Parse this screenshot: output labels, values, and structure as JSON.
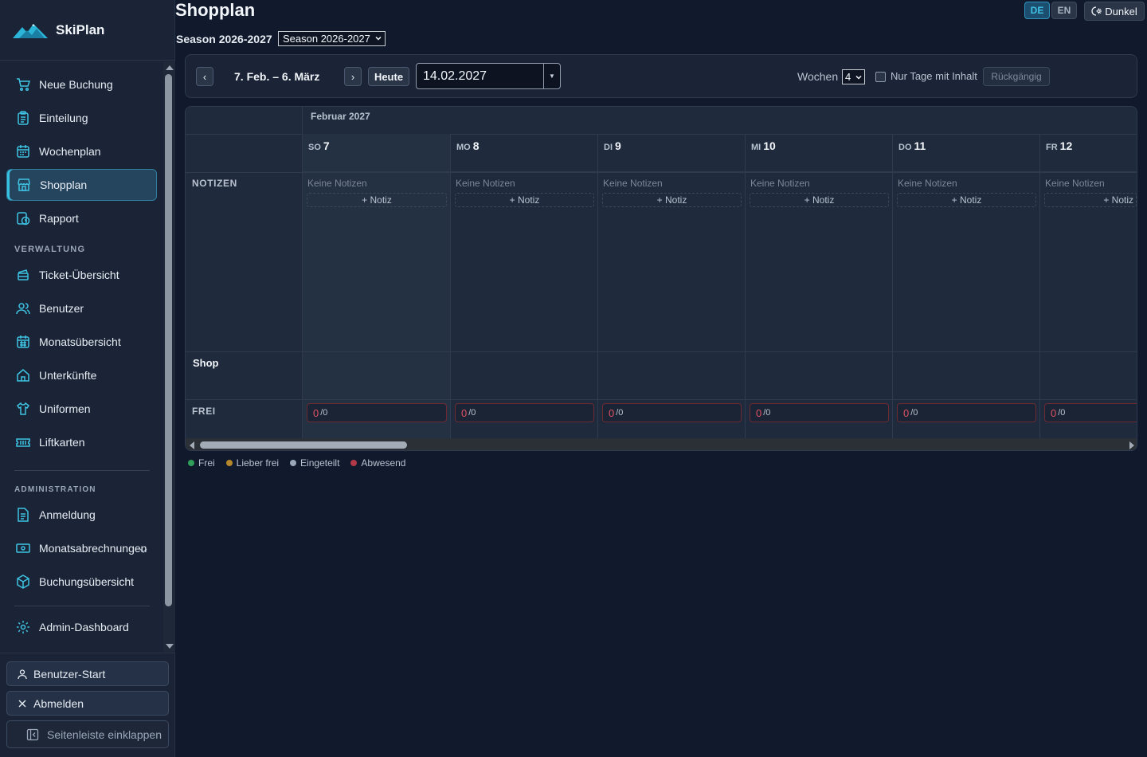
{
  "app": {
    "name": "SkiPlan"
  },
  "sidebar": {
    "items": [
      {
        "label": "Neue Buchung",
        "icon": "cart-icon"
      },
      {
        "label": "Einteilung",
        "icon": "clipboard-icon"
      },
      {
        "label": "Wochenplan",
        "icon": "calendar-icon"
      },
      {
        "label": "Shopplan",
        "icon": "store-icon",
        "active": true
      },
      {
        "label": "Rapport",
        "icon": "report-clock-icon"
      }
    ],
    "section_verwaltung": "VERWALTUNG",
    "verwaltung_items": [
      {
        "label": "Ticket-Übersicht",
        "icon": "ticket-icon"
      },
      {
        "label": "Benutzer",
        "icon": "users-icon"
      },
      {
        "label": "Monatsübersicht",
        "icon": "calendar-grid-icon"
      },
      {
        "label": "Unterkünfte",
        "icon": "home-icon"
      },
      {
        "label": "Uniformen",
        "icon": "shirt-icon"
      },
      {
        "label": "Liftkarten",
        "icon": "card-ticket-icon"
      }
    ],
    "section_admin": "ADMINISTRATION",
    "admin_items": [
      {
        "label": "Anmeldung",
        "icon": "document-icon"
      },
      {
        "label": "Monatsabrechnungen",
        "icon": "money-icon"
      },
      {
        "label": "Buchungsübersicht",
        "icon": "box-icon"
      }
    ],
    "dashboard": {
      "label": "Admin-Dashboard",
      "icon": "gear-icon"
    },
    "bottom": {
      "user_start": "Benutzer-Start",
      "logout": "Abmelden",
      "collapse": "Seitenleiste einklappen"
    }
  },
  "header": {
    "title": "Shopplan",
    "season_label": "Season 2026-2027",
    "season_select": "Season 2026-2027",
    "lang": [
      "DE",
      "EN"
    ],
    "lang_active": "DE",
    "theme": "Dunkel"
  },
  "toolbar": {
    "prev": "‹",
    "next": "›",
    "range": "7. Feb. – 6. März",
    "today": "Heute",
    "date": "14.02.2027",
    "weeks_label": "Wochen",
    "weeks_value": "4",
    "only_content_label": "Nur Tage mit Inhalt",
    "undo": "Rückgängig"
  },
  "calendar": {
    "month": "Februar 2027",
    "rows": {
      "notes": "NOTIZEN",
      "shop": "Shop",
      "free": "FREI"
    },
    "days": [
      {
        "dow": "SO",
        "num": "7",
        "today": true,
        "notes": "Keine Notizen",
        "add": "+ Notiz",
        "free": "0",
        "total": "/0"
      },
      {
        "dow": "MO",
        "num": "8",
        "notes": "Keine Notizen",
        "add": "+ Notiz",
        "free": "0",
        "total": "/0"
      },
      {
        "dow": "DI",
        "num": "9",
        "notes": "Keine Notizen",
        "add": "+ Notiz",
        "free": "0",
        "total": "/0"
      },
      {
        "dow": "MI",
        "num": "10",
        "notes": "Keine Notizen",
        "add": "+ Notiz",
        "free": "0",
        "total": "/0"
      },
      {
        "dow": "DO",
        "num": "11",
        "notes": "Keine Notizen",
        "add": "+ Notiz",
        "free": "0",
        "total": "/0"
      },
      {
        "dow": "FR",
        "num": "12",
        "notes": "Keine Notizen",
        "add": "+ Notiz",
        "free": "0",
        "total": "/0"
      }
    ]
  },
  "legend": [
    {
      "label": "Frei",
      "color": "#2f9e5a"
    },
    {
      "label": "Lieber frei",
      "color": "#b8862b"
    },
    {
      "label": "Eingeteilt",
      "color": "#9aa7b8"
    },
    {
      "label": "Abwesend",
      "color": "#b23a48"
    }
  ],
  "colors": {
    "accent": "#37c0e0",
    "bg": "#111a2c",
    "sidebar": "#1a2436",
    "alert": "#e05263"
  }
}
